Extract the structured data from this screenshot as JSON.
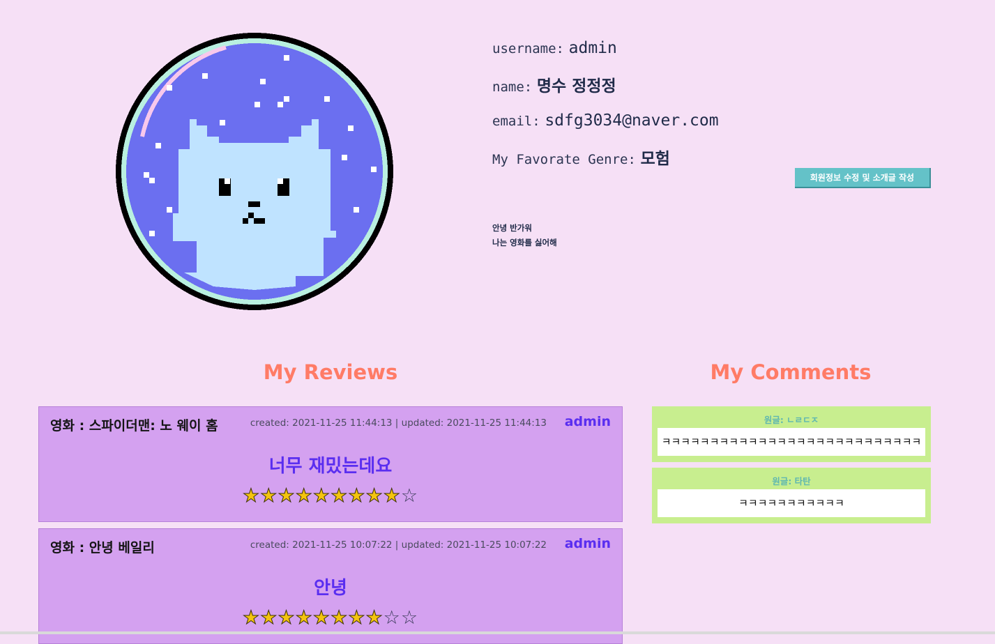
{
  "profile": {
    "username_label": "username:",
    "username": "admin",
    "name_label": "name:",
    "name": "명수 정정정",
    "email_label": "email:",
    "email": "sdfg3034@naver.com",
    "genre_label": "My Favorate Genre:",
    "genre": "모험",
    "edit_button": "회원정보 수정 및 소개글 작성",
    "intro_lines": [
      "안녕 반가워",
      "나는 영화를 싫어해"
    ]
  },
  "avatar": {
    "icon": "pixel-cat-icon"
  },
  "sections": {
    "reviews_title": "My Reviews",
    "comments_title": "My Comments"
  },
  "reviews": [
    {
      "movie": "영화 : 스파이더맨: 노 웨이 홈",
      "dates": "created: 2021-11-25 11:44:13 | updated: 2021-11-25 11:44:13",
      "author": "admin",
      "content": "너무 재밌는데요",
      "rating": 9,
      "max_rating": 10
    },
    {
      "movie": "영화 : 안녕 베일리",
      "dates": "created: 2021-11-25 10:07:22 | updated: 2021-11-25 10:07:22",
      "author": "admin",
      "content": "안녕",
      "rating": 8,
      "max_rating": 10
    }
  ],
  "comments": [
    {
      "original": "원글: ㄴㄹㄷㅈ",
      "text": "ㅋㅋㅋㅋㅋㅋㅋㅋㅋㅋㅋㅋㅋㅋㅋㅋㅋㅋㅋㅋㅋㅋㅋㅋㅋㅋㅋ"
    },
    {
      "original": "원글: 타탄",
      "text": "ㅋㅋㅋㅋㅋㅋㅋㅋㅋㅋㅋ"
    }
  ],
  "colors": {
    "background": "#f6e0f6",
    "accent_title": "#ff7b66",
    "review_bg": "#d4a1f0",
    "comment_bg": "#c8ee8f",
    "author": "#5a2ef0"
  }
}
